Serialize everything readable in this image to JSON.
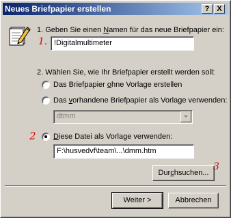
{
  "window": {
    "title": "Neues Briefpapier erstellen",
    "help_label": "?",
    "close_label": "X"
  },
  "step1": {
    "text_before": "1. Geben Sie einen ",
    "underlined": "N",
    "text_after": "amen für das neue Briefpapier ein:",
    "value": "!Digitalmultimeter"
  },
  "step2": {
    "label": "2. Wählen Sie, wie Ihr Briefpapier erstellt werden soll:",
    "options": [
      {
        "pre": "Das Briefpapier ",
        "u": "o",
        "post": "hne Vorlage erstellen",
        "checked": false
      },
      {
        "pre": "Das ",
        "u": "v",
        "post": "orhandene Briefpapier als Vorlage verwenden:",
        "checked": false
      },
      {
        "pre": "",
        "u": "D",
        "post": "iese Datei als Vorlage verwenden:",
        "checked": true
      }
    ],
    "combo_value": "dtmm",
    "file_path": "F:\\husvedvf\\team\\...\\dmm.htm"
  },
  "buttons": {
    "browse_pre": "Dur",
    "browse_u": "c",
    "browse_post": "hsuchen...",
    "next_label": "Weiter >",
    "cancel_label": "Abbrechen"
  },
  "annotations": {
    "a1": "1.",
    "a2": "2",
    "a3": "3"
  },
  "colors": {
    "annotation": "#e00000",
    "titlebar_start": "#0a246a",
    "titlebar_end": "#a6caf0"
  }
}
